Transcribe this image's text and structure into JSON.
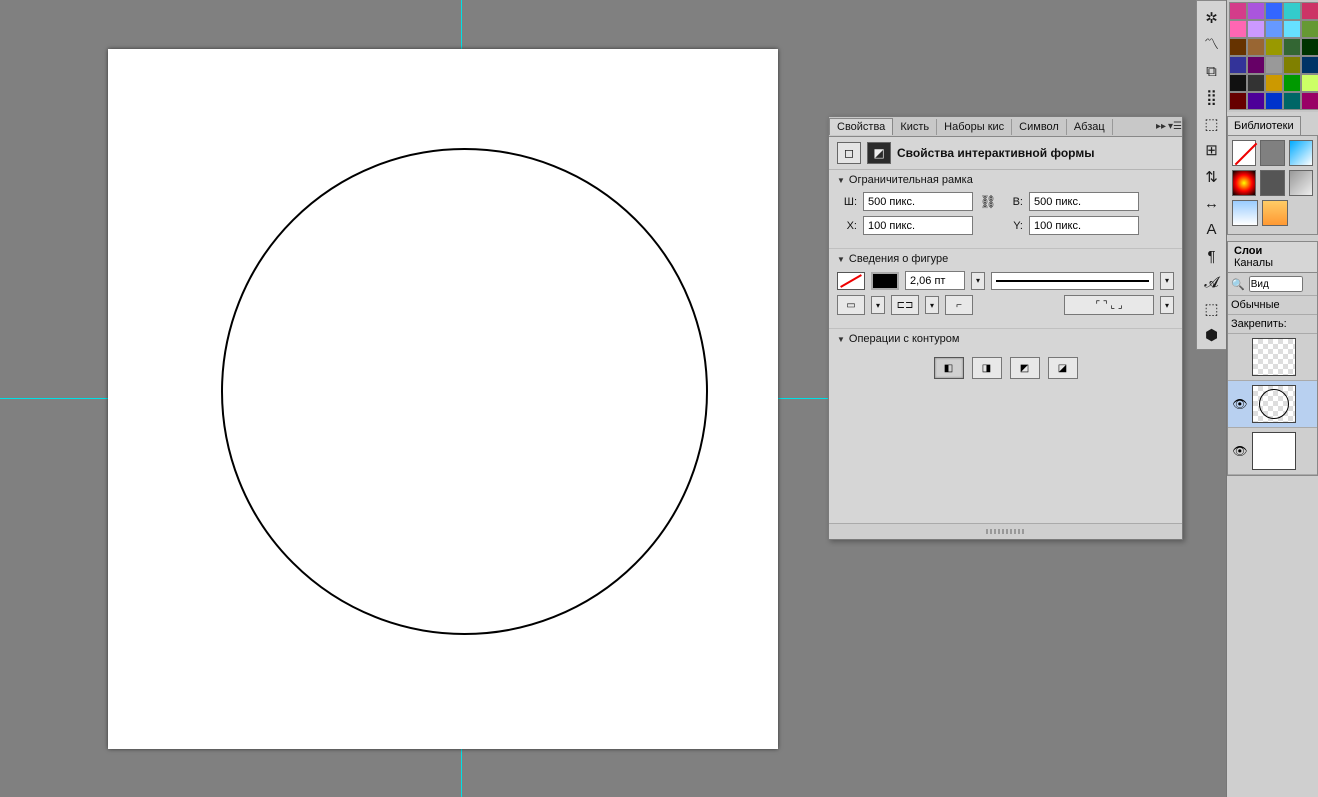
{
  "panel": {
    "tabs": [
      "Свойства",
      "Кисть",
      "Наборы кис",
      "Символ",
      "Абзац"
    ],
    "active_tab": 0,
    "title": "Свойства интерактивной формы",
    "sec_bounds": "Ограничительная рамка",
    "sec_shape": "Сведения о фигуре",
    "sec_pathops": "Операции с контуром",
    "labels": {
      "w": "Ш:",
      "h": "В:",
      "x": "X:",
      "y": "Y:"
    },
    "values": {
      "w": "500 пикс.",
      "h": "500 пикс.",
      "x": "100 пикс.",
      "y": "100 пикс.",
      "stroke": "2,06 пт"
    }
  },
  "right": {
    "lib_tab": "Библиотеки",
    "layers_tab": "Слои",
    "channels_tab": "Каналы",
    "search_label": "Вид",
    "blend_label": "Обычные",
    "lock_label": "Закрепить:",
    "search_icon": "🔍"
  },
  "toolstrip_icons": [
    "✲",
    "〽",
    "⧉",
    "⣿",
    "⬚",
    "⊞",
    "⇅",
    "↔",
    "A",
    "¶",
    "𝓐",
    "⬚",
    "⬢"
  ],
  "swatch_colors": [
    "#d43c8a",
    "#aa55dd",
    "#3366ff",
    "#33cccc",
    "#cc3366",
    "#ff66b3",
    "#cc99ff",
    "#6699ff",
    "#66e0ff",
    "#669933",
    "#663300",
    "#996633",
    "#999900",
    "#336633",
    "#003300",
    "#333399",
    "#660066",
    "#999999",
    "#808000",
    "#003366",
    "#111111",
    "#333333",
    "#cc9900",
    "#009900",
    "#ccff66",
    "#660000",
    "#4d0099",
    "#0033cc",
    "#006666",
    "#990066"
  ]
}
